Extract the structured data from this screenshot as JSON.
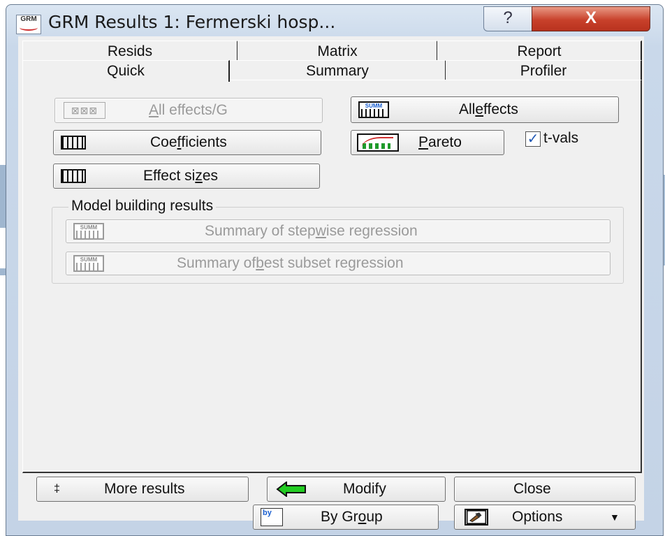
{
  "window": {
    "title": "GRM Results 1: Fermerski hosp...",
    "help_icon": "?",
    "close_icon": "X"
  },
  "tabs": {
    "row_back": [
      {
        "label": "Resids"
      },
      {
        "label": "Matrix"
      },
      {
        "label": "Report"
      }
    ],
    "row_front": [
      {
        "label": "Quick"
      },
      {
        "label": "Summary"
      },
      {
        "label": "Profiler"
      }
    ],
    "selected": "Quick"
  },
  "quick": {
    "all_effects_g": {
      "pre": "",
      "u": "A",
      "post": "ll effects/G",
      "enabled": false
    },
    "all_effects": {
      "pre": "All ",
      "u": "e",
      "post": "ffects",
      "icon": "summary-grid-icon"
    },
    "coefficients": {
      "pre": "Coe",
      "u": "f",
      "post": "ficients",
      "icon": "table-grid-icon"
    },
    "pareto": {
      "pre": "",
      "u": "P",
      "post": "areto",
      "icon": "pareto-chart-icon"
    },
    "tvals": {
      "label": "t-vals",
      "checked": true
    },
    "effect_sizes": {
      "pre": "Effect si",
      "u": "z",
      "post": "es",
      "icon": "table-grid-icon"
    }
  },
  "model_building": {
    "title": "Model building results",
    "stepwise": {
      "pre": "Summary of step",
      "u": "w",
      "post": "ise regression",
      "enabled": false
    },
    "best_subset": {
      "pre": "Summary of ",
      "u": "b",
      "post": "est subset regression",
      "enabled": false
    }
  },
  "footer": {
    "more_results": "More results",
    "more_results_icon": "‡",
    "modify": "Modify",
    "close": "Close",
    "by_group": {
      "pre": "By Gr",
      "u": "o",
      "post": "up"
    },
    "by_group_icon_text": "by",
    "options": "Options",
    "options_caret": "▼"
  },
  "colors": {
    "accent_arrow": "#22cc22",
    "close_button": "#c8412b",
    "checkbox_mark": "#2259b5"
  }
}
